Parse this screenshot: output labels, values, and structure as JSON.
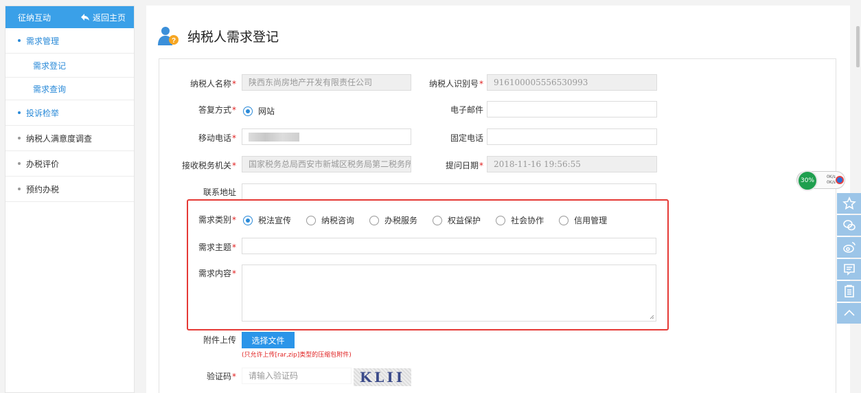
{
  "sidebar": {
    "header_title": "征纳互动",
    "back_label": "返回主页",
    "items": [
      {
        "label": "需求管理"
      },
      {
        "label": "投诉检举"
      },
      {
        "label": "纳税人满意度调查"
      },
      {
        "label": "办税评价"
      },
      {
        "label": "预约办税"
      }
    ],
    "sub_items": [
      {
        "label": "需求登记"
      },
      {
        "label": "需求查询"
      }
    ]
  },
  "page": {
    "title": "纳税人需求登记"
  },
  "form": {
    "taxpayer_name_label": "纳税人名称",
    "taxpayer_name_value": "陕西东尚房地产开发有限责任公司",
    "taxpayer_id_label": "纳税人识别号",
    "taxpayer_id_value": "916100005556530993",
    "reply_method_label": "答复方式",
    "reply_method_option": "网站",
    "email_label": "电子邮件",
    "mobile_label": "移动电话",
    "landline_label": "固定电话",
    "tax_office_label": "接收税务机关",
    "tax_office_value": "国家税务总局西安市新城区税务局第二税务所",
    "date_label": "提问日期",
    "date_value": "2018-11-16 19:56:55",
    "address_label": "联系地址",
    "category_label": "需求类别",
    "categories": [
      "税法宣传",
      "纳税咨询",
      "办税服务",
      "权益保护",
      "社会协作",
      "信用管理"
    ],
    "subject_label": "需求主题",
    "content_label": "需求内容",
    "attachment_label": "附件上传",
    "attachment_button": "选择文件",
    "attachment_note": "(只允许上传[rar,zip]类型的压缩包附件)",
    "captcha_label": "验证码",
    "captcha_placeholder": "请输入验证码",
    "captcha_text": "KLII",
    "required_mark": "*"
  },
  "floating": {
    "speed_percent": "30%",
    "speed_up": "0K/s",
    "speed_down": "0K/s"
  },
  "colors": {
    "accent": "#2b95e9",
    "sidebar_header": "#3aa0e8",
    "required": "#e02020",
    "highlight_box": "#e53935"
  }
}
